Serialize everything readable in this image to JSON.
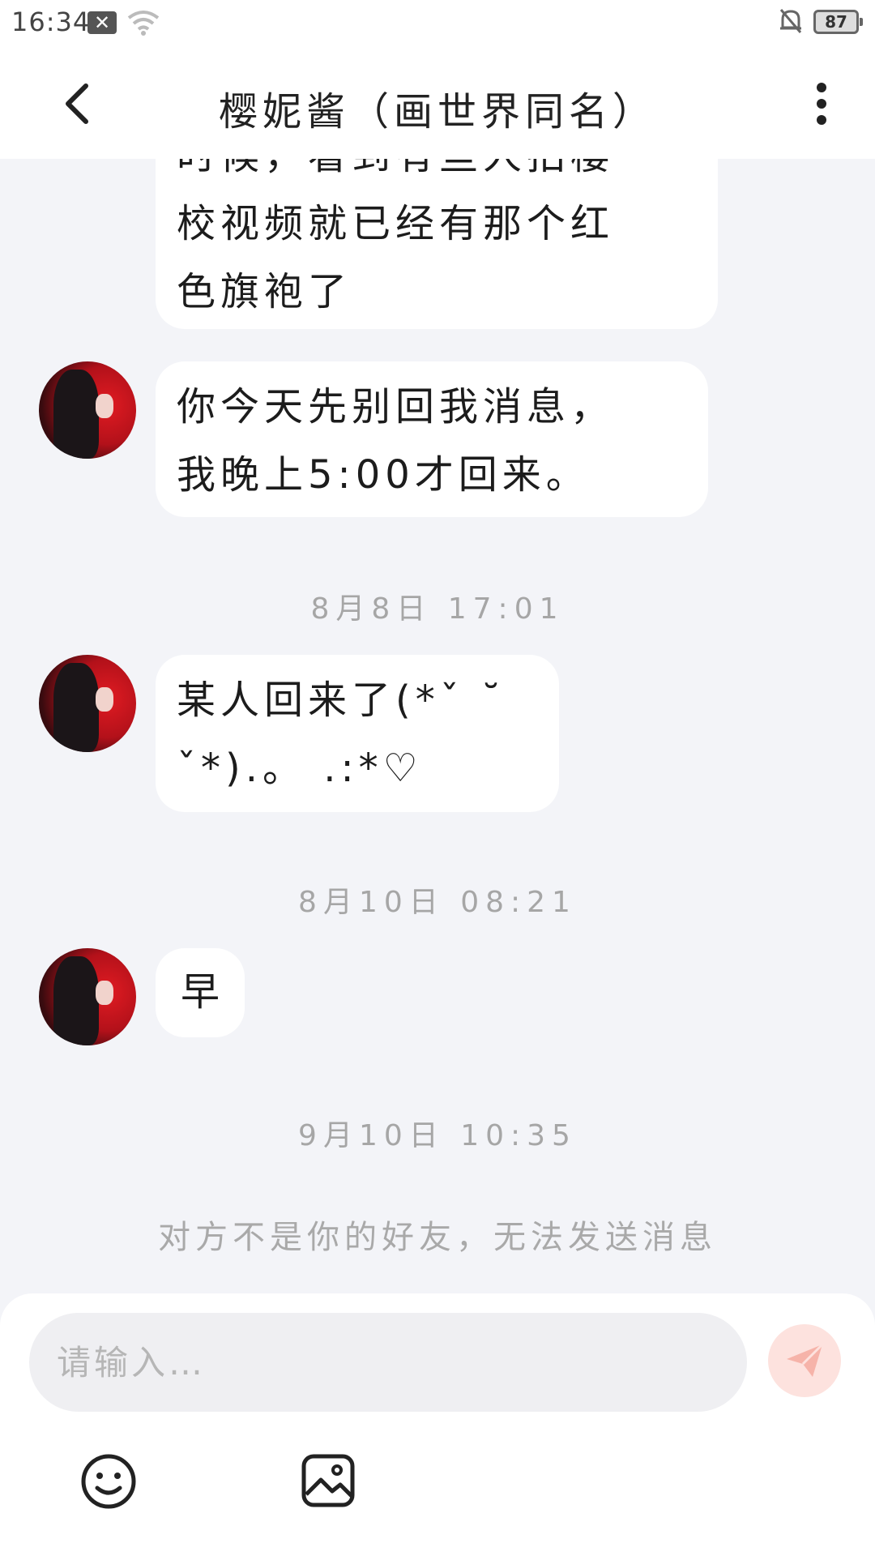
{
  "status_bar": {
    "time": "16:34",
    "battery": "87",
    "icons": [
      "x-notification-icon",
      "wifi-icon",
      "bell-muted-icon",
      "battery-icon"
    ]
  },
  "header": {
    "title": "樱妮酱（画世界同名）",
    "back_icon": "back-arrow-icon",
    "more_icon": "more-vertical-icon"
  },
  "messages": [
    {
      "type": "partial",
      "lines": [
        "时候，看到有些人拍樱",
        "校视频就已经有那个红",
        "色旗袍了"
      ]
    },
    {
      "type": "incoming",
      "lines": [
        "你今天先别回我消息，",
        "我晚上5:00才回来。"
      ]
    },
    {
      "type": "time",
      "text": "8月8日 17:01"
    },
    {
      "type": "incoming",
      "lines": [
        "某人回来了(*ˇ ˘",
        "ˇ*).。 .:*♡"
      ]
    },
    {
      "type": "time",
      "text": "8月10日 08:21"
    },
    {
      "type": "incoming",
      "lines": [
        "早"
      ]
    },
    {
      "type": "time",
      "text": "9月10日 10:35"
    }
  ],
  "notice": "对方不是你的好友，无法发送消息",
  "input": {
    "placeholder": "请输入…",
    "value": ""
  },
  "toolbar": {
    "emoji_icon": "smile-icon",
    "image_icon": "image-icon",
    "send_icon": "send-icon"
  },
  "colors": {
    "background": "#f3f4f8",
    "bubble": "#ffffff",
    "send_button": "#fde2de",
    "send_icon": "#f6b3a9",
    "timestamp_text": "#a6a6a6"
  }
}
